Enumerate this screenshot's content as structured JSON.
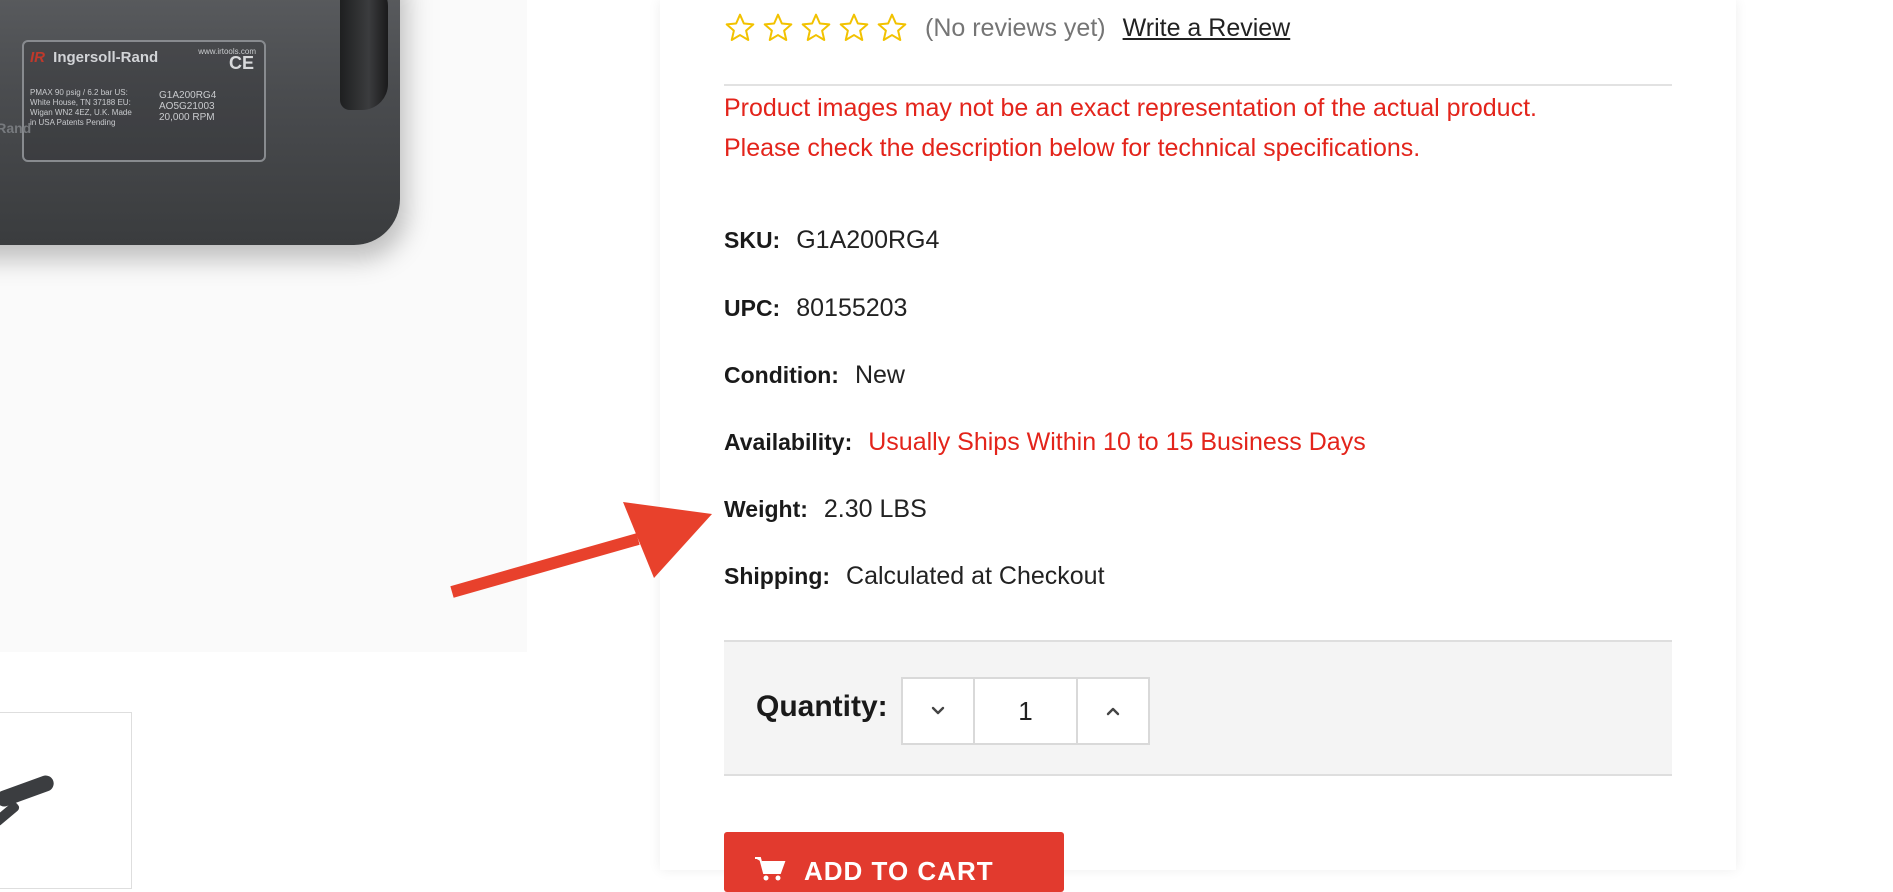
{
  "product_image": {
    "brand": "Ingersoll-Rand",
    "brand_mark": "IR",
    "plate_url": "www.irtools.com",
    "plate_ce": "CE",
    "plate_spec": "PMAX 90 psig / 6.2 bar US: White House, TN 37188 EU: Wigan WN2 4EZ, U.K. Made in USA  Patents Pending",
    "plate_model_lines": [
      "G1A200RG4",
      "AO5G21003",
      "20,000 RPM"
    ],
    "side_text": "IR  ollRand"
  },
  "rating": {
    "stars_total": 5,
    "stars_filled": 0,
    "star_color": "#f2c200",
    "reviews_text": "(No reviews yet)",
    "write_review_label": "Write a Review"
  },
  "disclaimer": {
    "line1": "Product images may not be an exact representation of the actual product.",
    "line2": "Please check the description below for technical specifications."
  },
  "specs": {
    "sku": {
      "label": "SKU:",
      "value": "G1A200RG4"
    },
    "upc": {
      "label": "UPC:",
      "value": "80155203"
    },
    "condition": {
      "label": "Condition:",
      "value": "New"
    },
    "availability": {
      "label": "Availability:",
      "value": "Usually Ships Within 10 to 15 Business Days"
    },
    "weight": {
      "label": "Weight:",
      "value": "2.30 LBS"
    },
    "shipping": {
      "label": "Shipping:",
      "value": "Calculated at Checkout"
    }
  },
  "quantity": {
    "label": "Quantity:",
    "value": "1",
    "decrement_icon": "chevron-down-icon",
    "increment_icon": "chevron-up-icon"
  },
  "cart": {
    "add_to_cart_label": "ADD TO CART",
    "icon": "cart-icon"
  },
  "colors": {
    "accent_red": "#e3241b",
    "button_red": "#e23a2e",
    "annotation_arrow": "#e8412c"
  }
}
